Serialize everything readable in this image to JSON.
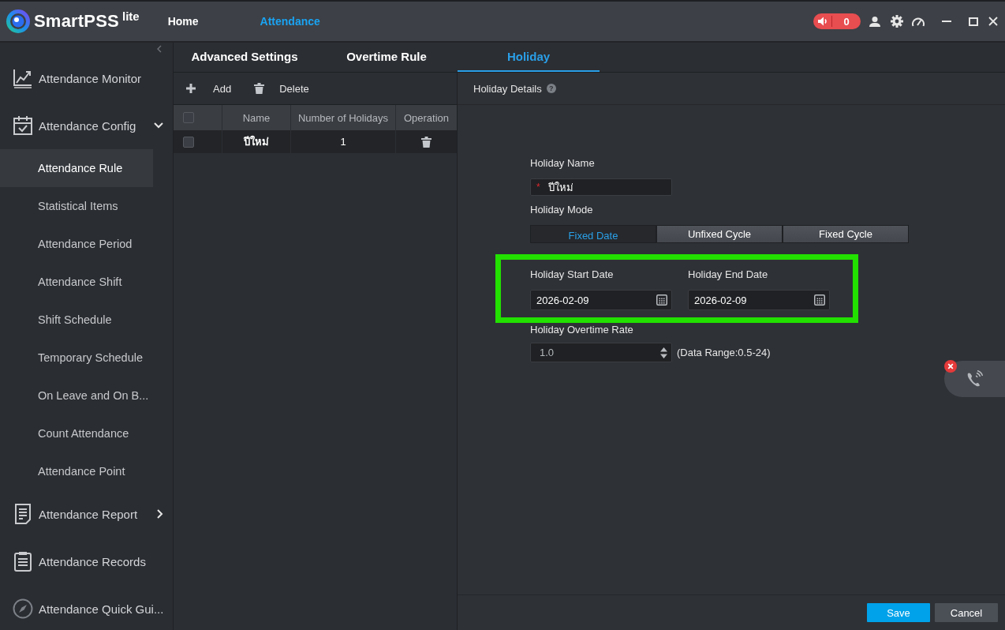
{
  "app_title": {
    "name": "SmartPSS",
    "edition": "lite"
  },
  "main_nav": [
    {
      "label": "Home",
      "selected": false
    },
    {
      "label": "Attendance",
      "selected": true
    }
  ],
  "alarm": {
    "count": "0"
  },
  "sidebar": {
    "items": [
      {
        "label": "Attendance Monitor",
        "selected": false
      },
      {
        "label": "Attendance Config",
        "selected": false,
        "expanded": true,
        "children": [
          {
            "label": "Attendance Rule",
            "selected": true
          },
          {
            "label": "Statistical Items",
            "selected": false
          },
          {
            "label": "Attendance Period",
            "selected": false
          },
          {
            "label": "Attendance Shift",
            "selected": false
          },
          {
            "label": "Shift Schedule",
            "selected": false
          },
          {
            "label": "Temporary Schedule",
            "selected": false
          },
          {
            "label": "On Leave and On B...",
            "selected": false
          },
          {
            "label": "Count Attendance",
            "selected": false
          },
          {
            "label": "Attendance Point",
            "selected": false
          }
        ]
      },
      {
        "label": "Attendance Report",
        "selected": false,
        "expanded": false
      },
      {
        "label": "Attendance Records",
        "selected": false
      },
      {
        "label": "Attendance Quick Gui...",
        "selected": false
      }
    ]
  },
  "tabs": [
    {
      "label": "Advanced Settings",
      "selected": false
    },
    {
      "label": "Overtime Rule",
      "selected": false
    },
    {
      "label": "Holiday",
      "selected": true
    }
  ],
  "toolbar": [
    {
      "label": "Add"
    },
    {
      "label": "Delete"
    }
  ],
  "table": {
    "all_checked": false,
    "columns": [
      "Name",
      "Number of Holidays",
      "Operation"
    ],
    "rows": [
      {
        "checked": false,
        "selected": true,
        "cells": [
          "ปีใหม่",
          "1"
        ]
      }
    ]
  },
  "details": {
    "title": "Holiday Details",
    "help_mark": "?",
    "name_label": "Holiday Name",
    "required_mark": "*",
    "name_value": "ปีใหม่",
    "mode_label": "Holiday Mode",
    "modes": [
      {
        "label": "Fixed Date",
        "selected": true
      },
      {
        "label": "Unfixed Cycle",
        "selected": false
      },
      {
        "label": "Fixed Cycle",
        "selected": false
      }
    ],
    "start_label": "Holiday Start Date",
    "start_value": "2026-02-09",
    "end_label": "Holiday End Date",
    "end_value": "2026-02-09",
    "rate_label": "Holiday Overtime Rate",
    "rate_value": "1.0",
    "rate_hint": "(Data Range:0.5-24)"
  },
  "footer_buttons": [
    {
      "label": "Save",
      "kind": "primary"
    },
    {
      "label": "Cancel",
      "kind": "secondary"
    }
  ]
}
